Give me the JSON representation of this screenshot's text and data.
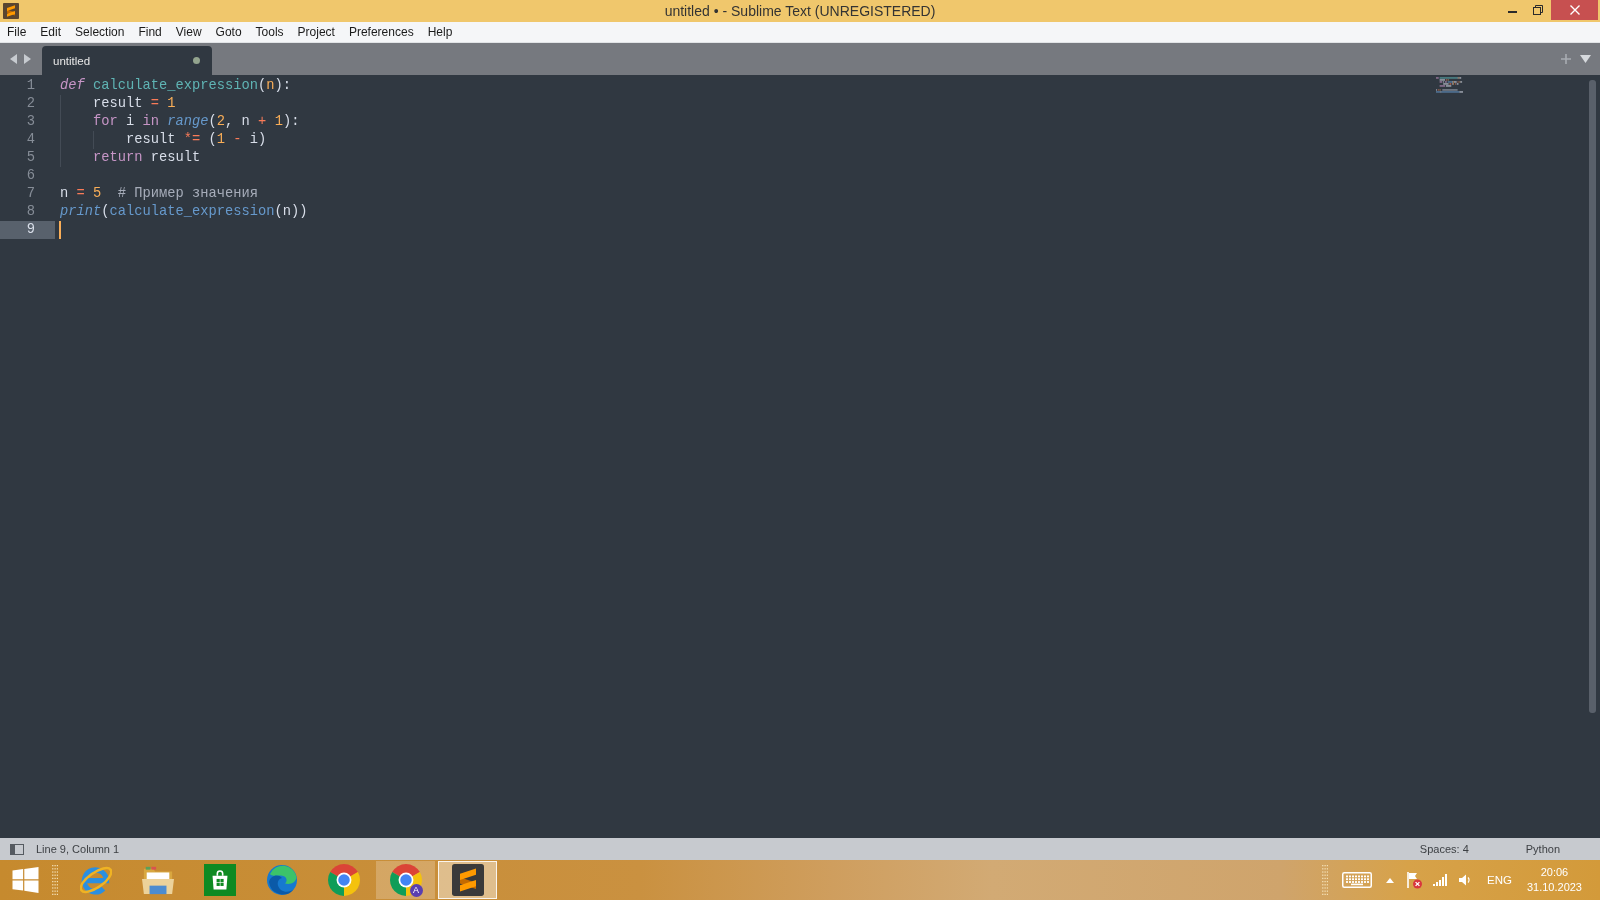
{
  "window": {
    "title": "untitled • - Sublime Text (UNREGISTERED)"
  },
  "menu": [
    "File",
    "Edit",
    "Selection",
    "Find",
    "View",
    "Goto",
    "Tools",
    "Project",
    "Preferences",
    "Help"
  ],
  "tabs": [
    {
      "label": "untitled",
      "selected": true,
      "modified": true
    }
  ],
  "editor": {
    "lines": [
      {
        "number": "1",
        "current": false,
        "tokens": [
          {
            "kind": "storage",
            "text": "def"
          },
          {
            "kind": "function",
            "text": " calculate_expression"
          },
          {
            "kind": "punct",
            "text": "("
          },
          {
            "kind": "param",
            "text": "n"
          },
          {
            "kind": "punct",
            "text": "):"
          }
        ]
      },
      {
        "number": "2",
        "current": false,
        "tokens": [
          {
            "kind": "plain",
            "text": "    result"
          },
          {
            "kind": "operator",
            "text": " ="
          },
          {
            "kind": "number",
            "text": " 1"
          }
        ]
      },
      {
        "number": "3",
        "current": false,
        "tokens": [
          {
            "kind": "keyword",
            "text": "    for"
          },
          {
            "kind": "plain",
            "text": " i"
          },
          {
            "kind": "keyword",
            "text": " in"
          },
          {
            "kind": "builtin",
            "text": " range"
          },
          {
            "kind": "punct",
            "text": "("
          },
          {
            "kind": "number",
            "text": "2"
          },
          {
            "kind": "plain",
            "text": ", n"
          },
          {
            "kind": "operator",
            "text": " +"
          },
          {
            "kind": "number",
            "text": " 1"
          },
          {
            "kind": "punct",
            "text": "):"
          }
        ]
      },
      {
        "number": "4",
        "current": false,
        "tokens": [
          {
            "kind": "plain",
            "text": "        result"
          },
          {
            "kind": "operator",
            "text": " *="
          },
          {
            "kind": "punct",
            "text": " ("
          },
          {
            "kind": "number",
            "text": "1"
          },
          {
            "kind": "operator",
            "text": " -"
          },
          {
            "kind": "plain",
            "text": " i)"
          }
        ]
      },
      {
        "number": "5",
        "current": false,
        "tokens": [
          {
            "kind": "keyword",
            "text": "    return"
          },
          {
            "kind": "plain",
            "text": " result"
          }
        ]
      },
      {
        "number": "6",
        "current": false
      },
      {
        "number": "7",
        "current": false,
        "tokens": [
          {
            "kind": "plain",
            "text": "n"
          },
          {
            "kind": "operator",
            "text": " ="
          },
          {
            "kind": "number",
            "text": " 5"
          },
          {
            "kind": "comment",
            "text": "  # Пример значения"
          }
        ]
      },
      {
        "number": "8",
        "current": false,
        "tokens": [
          {
            "kind": "builtin",
            "text": "print"
          },
          {
            "kind": "punct",
            "text": "("
          },
          {
            "kind": "call",
            "text": "calculate_expression"
          },
          {
            "kind": "punct",
            "text": "(n))"
          }
        ]
      },
      {
        "number": "9",
        "current": true
      }
    ]
  },
  "status_bar": {
    "position": "Line 9, Column 1",
    "indentation": "Spaces: 4",
    "syntax": "Python"
  },
  "taskbar": {
    "apps": [
      {
        "kind": "e-logo",
        "running": false,
        "selected": false
      },
      {
        "kind": "folder",
        "running": false,
        "selected": false
      },
      {
        "kind": "bag",
        "running": false,
        "selected": false
      },
      {
        "kind": "swirl",
        "running": false,
        "selected": false
      },
      {
        "kind": "ring",
        "running": false,
        "selected": false
      },
      {
        "kind": "ring",
        "running": true,
        "selected": false,
        "badge": "A"
      },
      {
        "kind": "s-logo",
        "running": true,
        "selected": true
      }
    ],
    "tray": {
      "language": "ENG",
      "time": "20:06",
      "date": "31.10.2023"
    }
  }
}
